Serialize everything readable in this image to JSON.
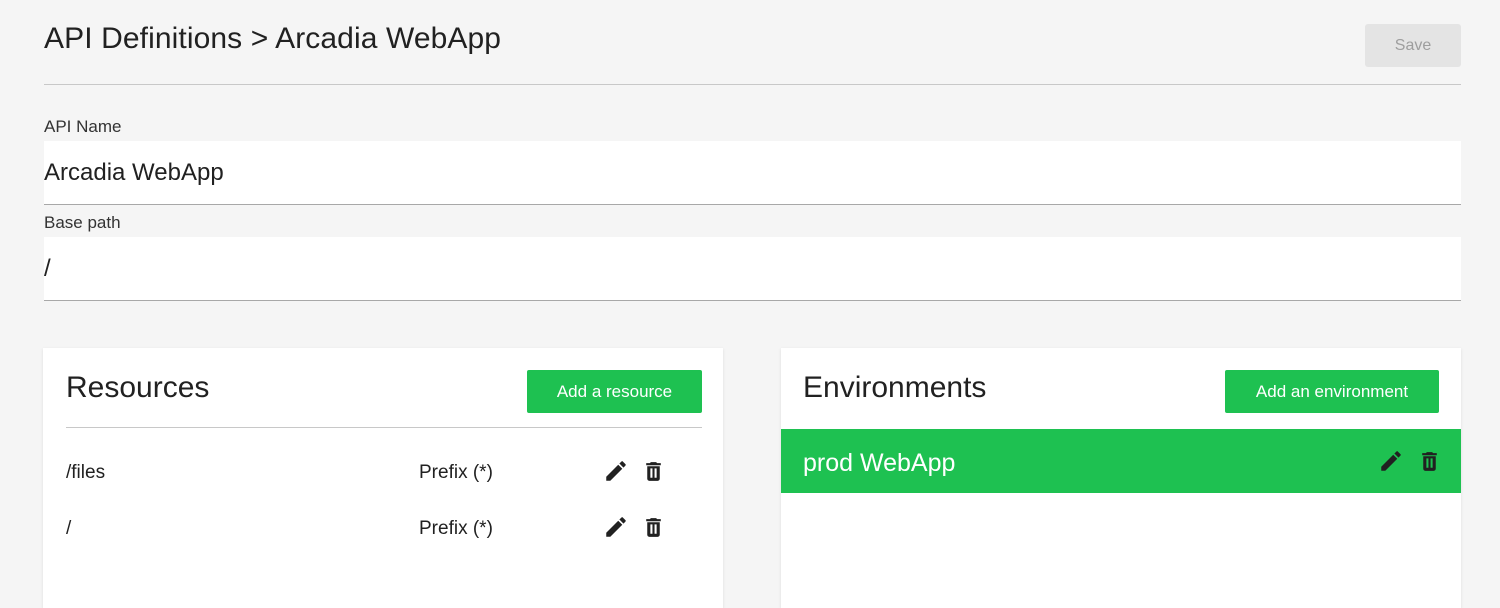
{
  "header": {
    "title": "API Definitions > Arcadia WebApp",
    "save_label": "Save"
  },
  "form": {
    "api_name": {
      "label": "API Name",
      "value": "Arcadia WebApp"
    },
    "base_path": {
      "label": "Base path",
      "value": "/"
    }
  },
  "resources": {
    "title": "Resources",
    "add_label": "Add a resource",
    "items": [
      {
        "path": "/files",
        "match": "Prefix (*)",
        "edit_icon": "pencil-icon",
        "delete_icon": "trash-icon"
      },
      {
        "path": "/",
        "match": "Prefix (*)",
        "edit_icon": "pencil-icon",
        "delete_icon": "trash-icon"
      }
    ]
  },
  "environments": {
    "title": "Environments",
    "add_label": "Add an environment",
    "items": [
      {
        "name": "prod WebApp",
        "edit_icon": "pencil-icon",
        "delete_icon": "trash-icon",
        "selected": true
      }
    ]
  },
  "colors": {
    "accent": "#1ec151",
    "background": "#f5f5f5",
    "card": "#ffffff",
    "save_disabled_bg": "#e4e4e4",
    "save_disabled_text": "#9e9e9e"
  }
}
